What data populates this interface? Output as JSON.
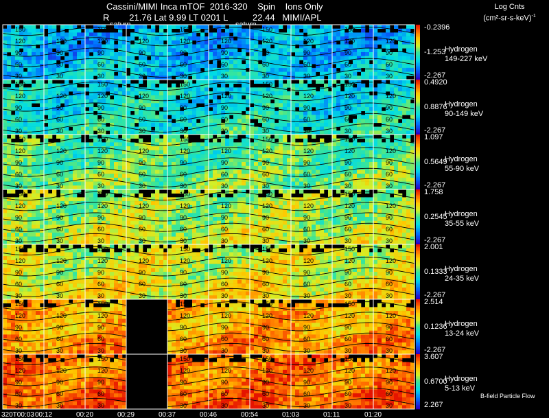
{
  "header": {
    "line1": "Cassini/MIMI Inca mTOF  2016-320    Spin    Ions Only",
    "line2_r_label": "R",
    "line2_values": "21.76 Lat 9.99 LT 0201 L",
    "line2_l_value": "22.44",
    "line2_org": "MIMI/APL",
    "tag_a": "saturn",
    "tag_b": "saturn",
    "units_line1": "Log Cnts",
    "units_line2": "(cm²-sr-s-keV)",
    "units_sup": "-1"
  },
  "footnote": "B-field Particle Flow",
  "chart_data": {
    "type": "heatmap",
    "x_tick_labels": [
      "320T00:03",
      "00:12",
      "00:20",
      "00:29",
      "00:37",
      "00:46",
      "00:54",
      "01:03",
      "01:11",
      "01:20"
    ],
    "y_tick_labels": [
      "30",
      "60",
      "90",
      "120",
      "150"
    ],
    "data_gap": {
      "from": "00:29 (approx.)",
      "to": "00:37 (approx.)",
      "panels": [
        "13-24 keV",
        "5-13 keV"
      ]
    },
    "panels": [
      {
        "species": "Hydrogen",
        "energy": "149-227 keV",
        "cbar_max": "-0.2396",
        "cbar_mid": "-1.253",
        "cbar_min": "-2.267",
        "level": 0.28
      },
      {
        "species": "Hydrogen",
        "energy": "90-149 keV",
        "cbar_max": "0.4920",
        "cbar_mid": "0.8876",
        "cbar_min": "-2.267",
        "level": 0.38
      },
      {
        "species": "Hydrogen",
        "energy": "55-90 keV",
        "cbar_max": "1.097",
        "cbar_mid": "0.5649",
        "cbar_min": "-2.267",
        "level": 0.5
      },
      {
        "species": "Hydrogen",
        "energy": "35-55 keV",
        "cbar_max": "1.758",
        "cbar_mid": "0.2545",
        "cbar_min": "-2.267",
        "level": 0.58
      },
      {
        "species": "Hydrogen",
        "energy": "24-35 keV",
        "cbar_max": "2.001",
        "cbar_mid": "0.1333",
        "cbar_min": "-2.267",
        "level": 0.64
      },
      {
        "species": "Hydrogen",
        "energy": "13-24 keV",
        "cbar_max": "2.514",
        "cbar_mid": "0.1236",
        "cbar_min": "-2.267",
        "level": 0.78
      },
      {
        "species": "Hydrogen",
        "energy": "5-13 keV",
        "cbar_max": "3.607",
        "cbar_mid": "0.6700",
        "cbar_min": "2.267",
        "level": 0.86
      }
    ]
  }
}
